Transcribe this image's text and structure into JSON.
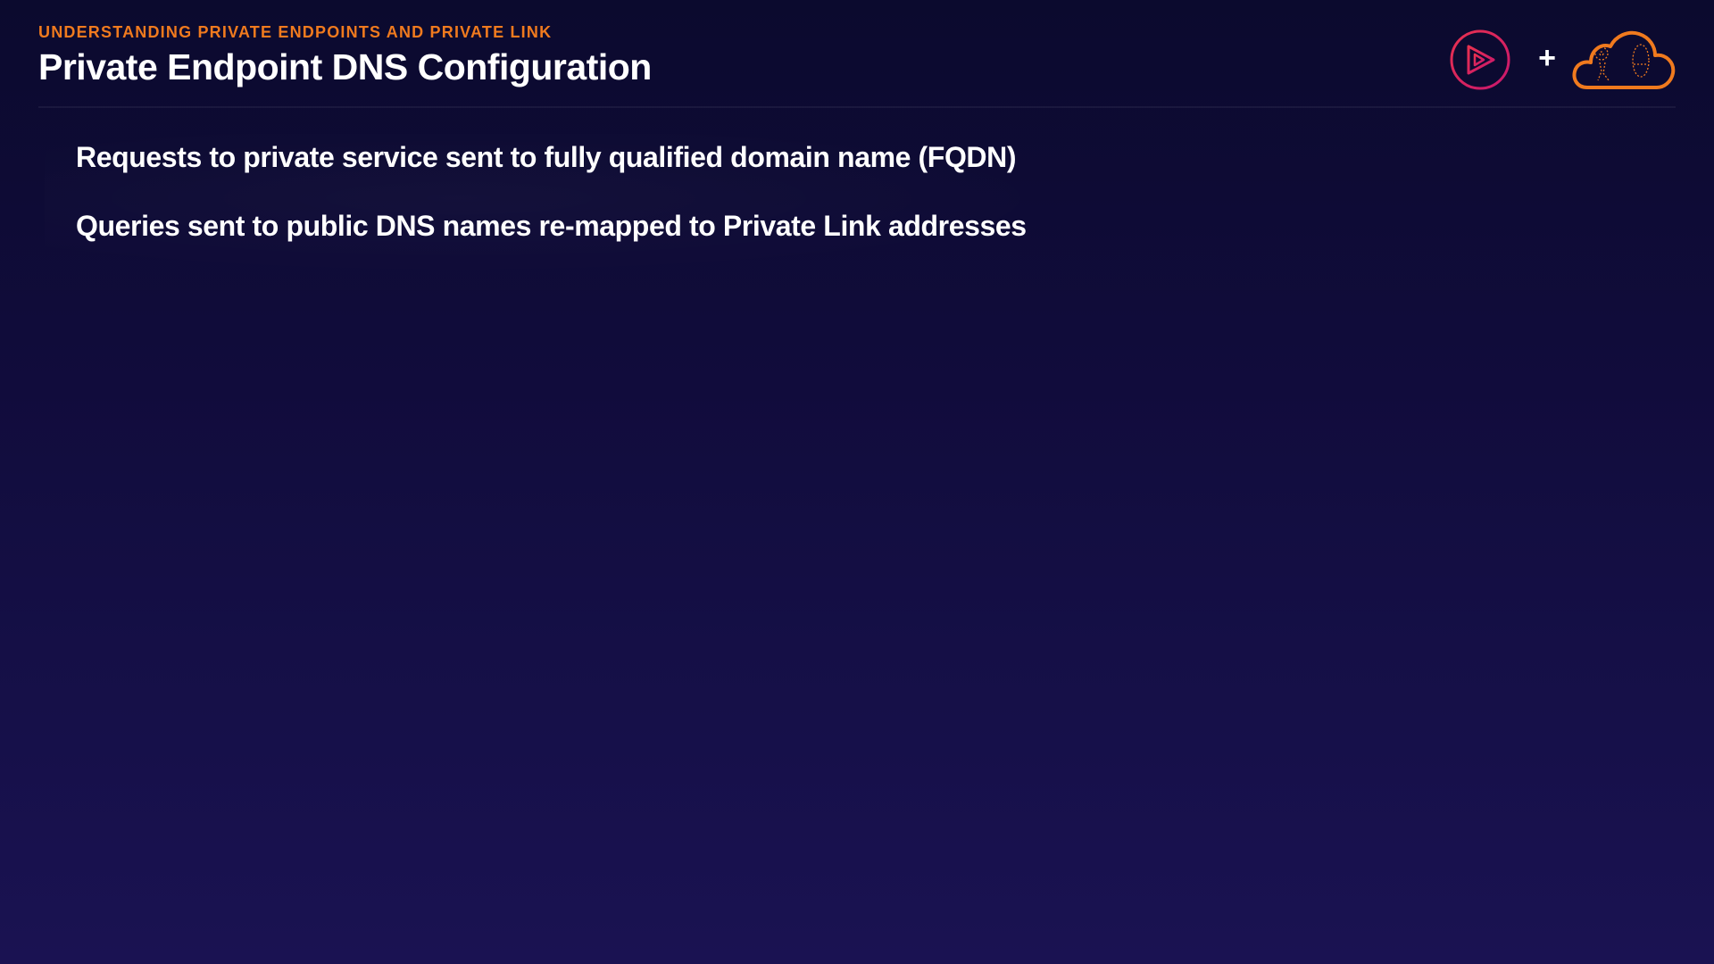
{
  "slide": {
    "section_label": "UNDERSTANDING PRIVATE ENDPOINTS AND PRIVATE LINK",
    "title": "Private Endpoint DNS Configuration",
    "bullets": [
      "Requests to private service sent to fully qualified domain name (FQDN)",
      "Queries sent to public DNS names re-mapped to Private Link addresses"
    ]
  },
  "logos": {
    "left_icon": "play-logo-icon",
    "separator": "+",
    "right_icon": "cloud-logo-icon"
  },
  "colors": {
    "background_top": "#0b0a2e",
    "background_bottom": "#1a1252",
    "accent_orange": "#f07a1e",
    "play_logo": "#e0245e",
    "text": "#ffffff"
  }
}
